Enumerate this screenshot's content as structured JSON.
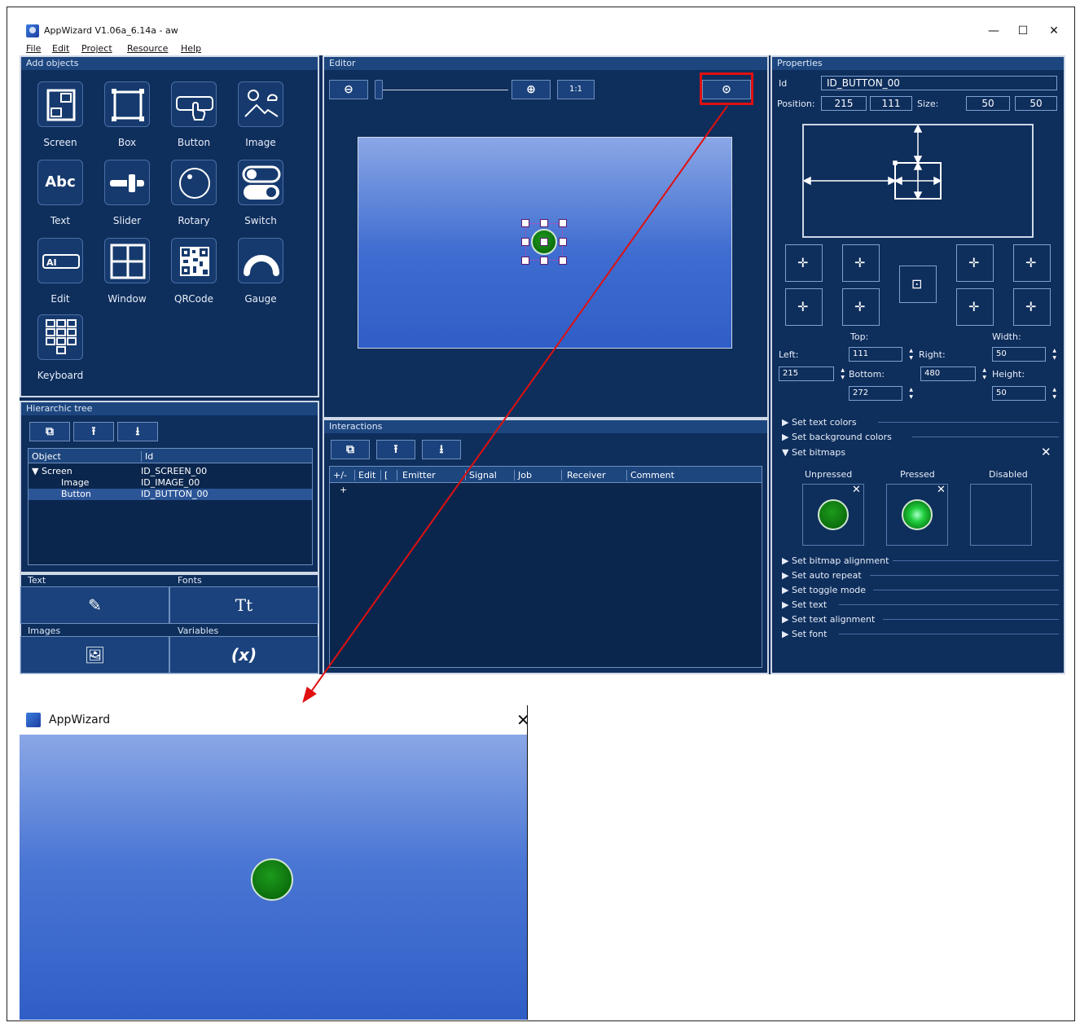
{
  "window": {
    "title": "AppWizard V1.06a_6.14a - aw",
    "minimize": "—",
    "maximize": "☐",
    "close": "✕"
  },
  "menu": [
    "File",
    "Edit",
    "Project",
    "Resource",
    "Help"
  ],
  "add_objects": {
    "header": "Add objects",
    "items": [
      "Screen",
      "Box",
      "Button",
      "Image",
      "Text",
      "Slider",
      "Rotary",
      "Switch",
      "Edit",
      "Window",
      "QRCode",
      "Gauge",
      "Keyboard"
    ],
    "text_icon_glyph": "Abc"
  },
  "hierarchic_tree": {
    "header": "Hierarchic tree",
    "col_object": "Object",
    "col_id": "Id",
    "rows": [
      {
        "object": "▼ Screen",
        "id": "ID_SCREEN_00"
      },
      {
        "object": "Image",
        "id": "ID_IMAGE_00"
      },
      {
        "object": "Button",
        "id": "ID_BUTTON_00"
      }
    ]
  },
  "resources": {
    "text": "Text",
    "fonts": "Fonts",
    "images": "Images",
    "variables": "Variables",
    "fonts_glyph": "Tt",
    "variables_glyph": "(x)"
  },
  "editor": {
    "header": "Editor",
    "zoom_one": "1:1"
  },
  "interactions": {
    "header": "Interactions",
    "columns": [
      "+/-",
      "Edit",
      "[",
      "Emitter",
      "Signal",
      "Job",
      "Receiver",
      "Comment"
    ],
    "add_row": "+"
  },
  "properties": {
    "header": "Properties",
    "id_label": "Id",
    "id_value": "ID_BUTTON_00",
    "position_label": "Position:",
    "pos_x": "215",
    "pos_y": "111",
    "size_label": "Size:",
    "size_w": "50",
    "size_h": "50",
    "top_label": "Top:",
    "width_label": "Width:",
    "left_label": "Left:",
    "right_label": "Right:",
    "bottom_label": "Bottom:",
    "height_label": "Height:",
    "top_value": "111",
    "width_value": "50",
    "left_value": "215",
    "right_value": "480",
    "bottom_value": "272",
    "height_value": "50",
    "sections": [
      "Set text colors",
      "Set background colors",
      "Set bitmaps",
      "Set bitmap alignment",
      "Set auto repeat",
      "Set toggle mode",
      "Set text",
      "Set text alignment",
      "Set font"
    ],
    "bitmap_states": [
      "Unpressed",
      "Pressed",
      "Disabled"
    ]
  },
  "preview": {
    "title": "AppWizard",
    "close": "✕"
  },
  "colors": {
    "app_bg": "#0e2e5c",
    "header_bg": "#1d467f",
    "highlight": "#e01010",
    "button_green": "#0c6f0c"
  }
}
